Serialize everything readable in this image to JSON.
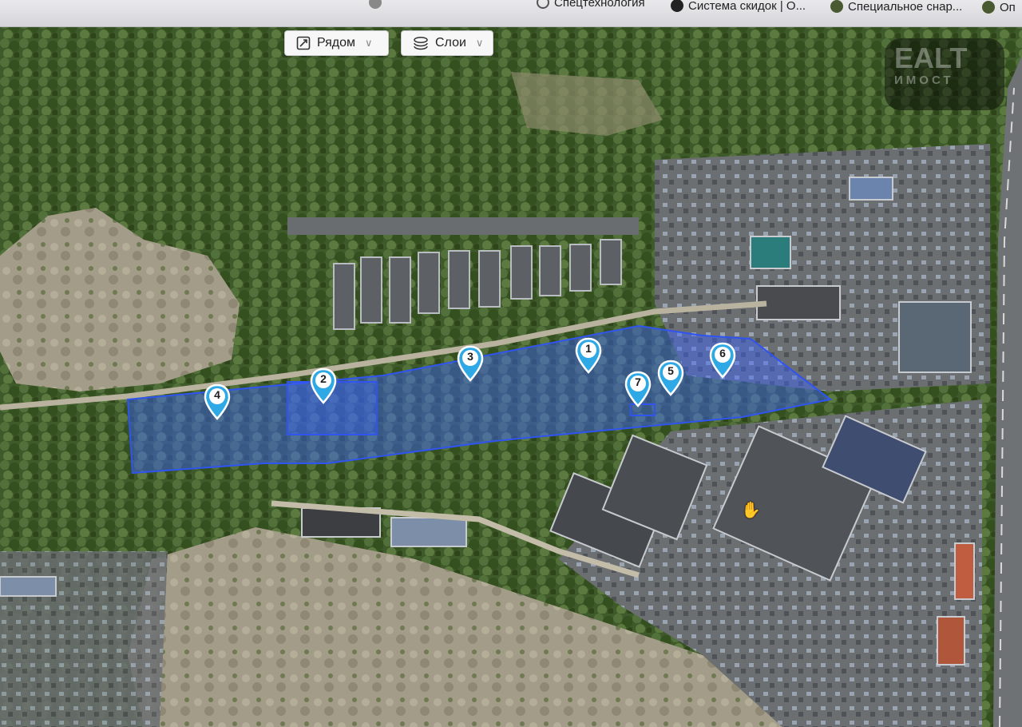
{
  "browser_bookmarks": [
    {
      "label": "",
      "icon": "bookmark-icon",
      "color": "#888888"
    },
    {
      "label": "Спецтехнология",
      "icon": "globe-icon",
      "color": "#555555"
    },
    {
      "label": "Система скидок | О...",
      "icon": "site-logo-icon",
      "color": "#222222"
    },
    {
      "label": "Специальное снар...",
      "icon": "site-logo-icon",
      "color": "#4a5a30"
    },
    {
      "label": "Оп",
      "icon": "site-logo-icon",
      "color": "#4a5a30"
    }
  ],
  "controls": {
    "nearby_label": "Рядом",
    "layers_label": "Слои"
  },
  "markers": [
    "4",
    "2",
    "3",
    "1",
    "7",
    "5",
    "6"
  ],
  "colors": {
    "plot_fill": "#3b63ff",
    "plot_stroke": "#2f54f0",
    "marker_fill": "#2fa9e6"
  },
  "watermark": {
    "line1": "EALT",
    "line2": "ИМОСТ"
  }
}
